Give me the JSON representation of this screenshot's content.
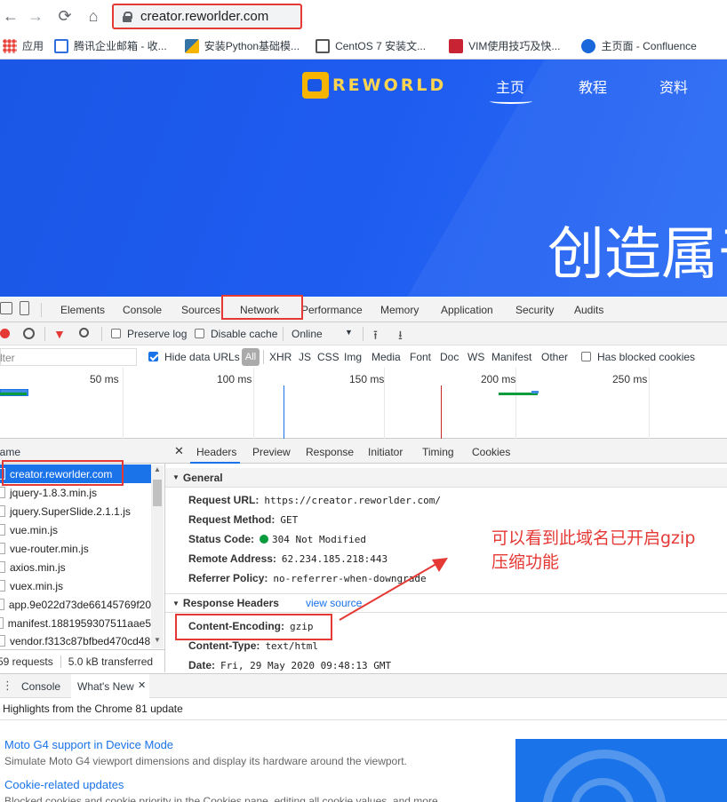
{
  "browser": {
    "url": "creator.reworlder.com",
    "bookmarks": [
      {
        "label": "应用",
        "icon": "apps-grid-icon",
        "color": "#e8453c"
      },
      {
        "label": "腾讯企业邮箱 - 收...",
        "icon": "tencent-mail-icon",
        "color": "#2f6fde"
      },
      {
        "label": "安装Python基础模...",
        "icon": "python-icon",
        "color": "#f4b400"
      },
      {
        "label": "CentOS 7 安装文...",
        "icon": "document-icon",
        "color": "#555555"
      },
      {
        "label": "VIM使用技巧及快...",
        "icon": "csdn-icon",
        "color": "#c82333"
      },
      {
        "label": "主页面 - Confluence",
        "icon": "confluence-icon",
        "color": "#1868db"
      }
    ]
  },
  "hero": {
    "logo_text": "REWORLD",
    "nav": [
      "主页",
      "教程",
      "资料"
    ],
    "title": "创造属于"
  },
  "devtools": {
    "tabs": [
      "Elements",
      "Console",
      "Sources",
      "Network",
      "Performance",
      "Memory",
      "Application",
      "Security",
      "Audits"
    ],
    "toolbar": {
      "preserve_log": "Preserve log",
      "disable_cache": "Disable cache",
      "throttle": "Online"
    },
    "filter": {
      "placeholder": "Filter",
      "hide_data_urls": "Hide data URLs",
      "types": [
        "All",
        "XHR",
        "JS",
        "CSS",
        "Img",
        "Media",
        "Font",
        "Doc",
        "WS",
        "Manifest",
        "Other"
      ],
      "has_blocked_cookies": "Has blocked cookies"
    },
    "timeline_ticks": [
      "50 ms",
      "100 ms",
      "150 ms",
      "200 ms",
      "250 ms"
    ],
    "request_list": {
      "header": "Name",
      "rows": [
        "creator.reworlder.com",
        "jquery-1.8.3.min.js",
        "jquery.SuperSlide.2.1.1.js",
        "vue.min.js",
        "vue-router.min.js",
        "axios.min.js",
        "vuex.min.js",
        "app.9e022d73de66145769f20",
        "manifest.1881959307511aae5",
        "vendor.f313c87bfbed470cd48"
      ],
      "requests": "59 requests",
      "transferred": "5.0 kB transferred"
    },
    "details": {
      "tabs": [
        "Headers",
        "Preview",
        "Response",
        "Initiator",
        "Timing",
        "Cookies"
      ],
      "general_title": "General",
      "general": [
        {
          "k": "Request URL:",
          "v": "https://creator.reworlder.com/"
        },
        {
          "k": "Request Method:",
          "v": "GET"
        },
        {
          "k": "Status Code:",
          "v": "304 Not Modified"
        },
        {
          "k": "Remote Address:",
          "v": "62.234.185.218:443"
        },
        {
          "k": "Referrer Policy:",
          "v": "no-referrer-when-downgrade"
        }
      ],
      "response_title": "Response Headers",
      "view_source": "view source",
      "response": [
        {
          "k": "Content-Encoding:",
          "v": "gzip"
        },
        {
          "k": "Content-Type:",
          "v": "text/html"
        },
        {
          "k": "Date:",
          "v": "Fri, 29 May 2020 09:48:13 GMT"
        }
      ]
    },
    "annotation": [
      "可以看到此域名已开启gzip",
      "压缩功能"
    ],
    "drawer": {
      "tabs": [
        "Console",
        "What's New"
      ],
      "highlights": "Highlights from the Chrome 81 update",
      "news": [
        {
          "title": "Moto G4 support in Device Mode",
          "desc": "Simulate Moto G4 viewport dimensions and display its hardware around the viewport."
        },
        {
          "title": "Cookie-related updates",
          "desc": "Blocked cookies and cookie priority in the Cookies pane, editing all cookie values, and more."
        }
      ]
    }
  }
}
